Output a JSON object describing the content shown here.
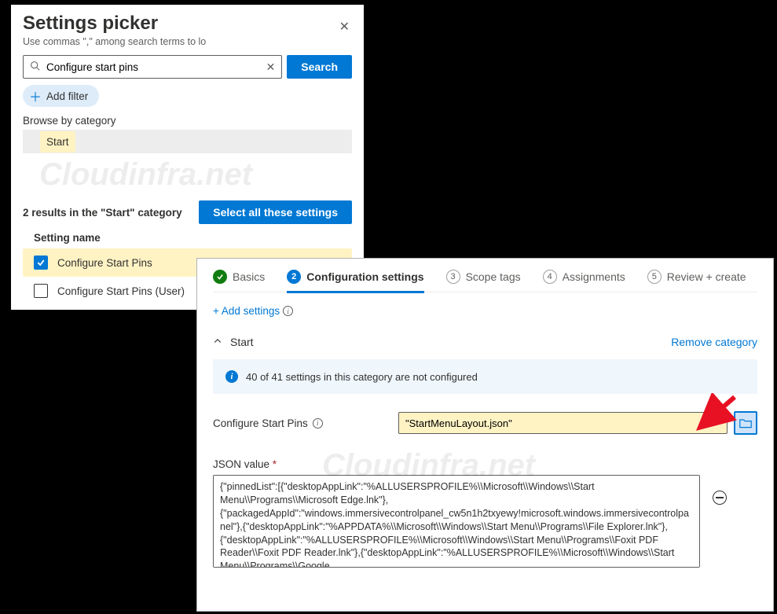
{
  "picker": {
    "title": "Settings picker",
    "subtitle": "Use commas \",\" among search terms to lo",
    "search_value": "Configure start pins",
    "search_btn": "Search",
    "add_filter": "Add filter",
    "browse_label": "Browse by category",
    "category": "Start",
    "results_label": "2 results in the \"Start\" category",
    "select_all": "Select all these settings",
    "column": "Setting name",
    "settings": [
      {
        "label": "Configure Start Pins",
        "checked": true
      },
      {
        "label": "Configure Start Pins (User)",
        "checked": false
      }
    ]
  },
  "wizard": {
    "steps": [
      {
        "label": "Basics",
        "state": "done"
      },
      {
        "num": "2",
        "label": "Configuration settings",
        "state": "active"
      },
      {
        "num": "3",
        "label": "Scope tags",
        "state": "pending"
      },
      {
        "num": "4",
        "label": "Assignments",
        "state": "pending"
      },
      {
        "num": "5",
        "label": "Review + create",
        "state": "pending"
      }
    ],
    "add_settings": "+ Add settings",
    "category_name": "Start",
    "remove": "Remove category",
    "not_configured": "40 of 41 settings in this category are not configured",
    "field_label": "Configure Start Pins",
    "file_value": "\"StartMenuLayout.json\"",
    "json_label": "JSON value",
    "json_value": "{\"pinnedList\":[{\"desktopAppLink\":\"%ALLUSERSPROFILE%\\\\Microsoft\\\\Windows\\\\Start Menu\\\\Programs\\\\Microsoft Edge.lnk\"},{\"packagedAppId\":\"windows.immersivecontrolpanel_cw5n1h2txyewy!microsoft.windows.immersivecontrolpanel\"},{\"desktopAppLink\":\"%APPDATA%\\\\Microsoft\\\\Windows\\\\Start Menu\\\\Programs\\\\File Explorer.lnk\"},{\"desktopAppLink\":\"%ALLUSERSPROFILE%\\\\Microsoft\\\\Windows\\\\Start Menu\\\\Programs\\\\Foxit PDF Reader\\\\Foxit PDF Reader.lnk\"},{\"desktopAppLink\":\"%ALLUSERSPROFILE%\\\\Microsoft\\\\Windows\\\\Start Menu\\\\Programs\\\\Google"
  },
  "watermark": "Cloudinfra.net"
}
